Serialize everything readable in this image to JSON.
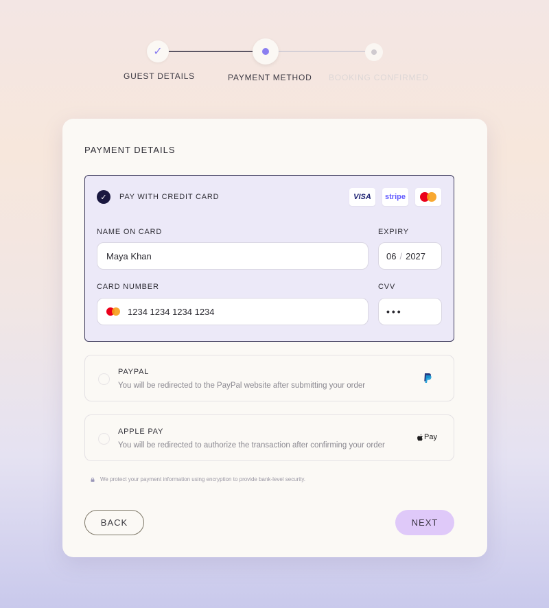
{
  "stepper": {
    "steps": [
      {
        "label": "GUEST DETAILS",
        "state": "completed"
      },
      {
        "label": "PAYMENT METHOD",
        "state": "current"
      },
      {
        "label": "BOOKING CONFIRMED",
        "state": "upcoming"
      }
    ]
  },
  "card": {
    "title": "PAYMENT DETAILS",
    "credit_card": {
      "title": "PAY WITH CREDIT CARD",
      "selected": true,
      "brands": {
        "visa": "VISA",
        "stripe": "stripe",
        "mastercard": "mastercard-icon"
      },
      "name_label": "NAME ON CARD",
      "name_value": "Maya Khan",
      "expiry_label": "EXPIRY",
      "expiry_month": "06",
      "expiry_slash": "/",
      "expiry_year": "2027",
      "number_label": "CARD NUMBER",
      "number_value": "1234 1234 1234 1234",
      "cvv_label": "CVV",
      "cvv_value": "•••"
    },
    "paypal": {
      "title": "PAYPAL",
      "description": "You will be redirected to the PayPal website after submitting your order",
      "selected": false
    },
    "apple_pay": {
      "title": "APPLE PAY",
      "description": "You will be redirected to authorize the transaction after confirming your order",
      "logo_text": "Pay",
      "selected": false
    },
    "security_note": "We protect your payment information using encryption to provide bank-level security.",
    "back_label": "BACK",
    "next_label": "NEXT"
  },
  "colors": {
    "accent": "#8a7ef0",
    "selected_border": "#3d3a5c",
    "selected_bg": "#ece9f8",
    "next_button": "#dfc9f9"
  }
}
